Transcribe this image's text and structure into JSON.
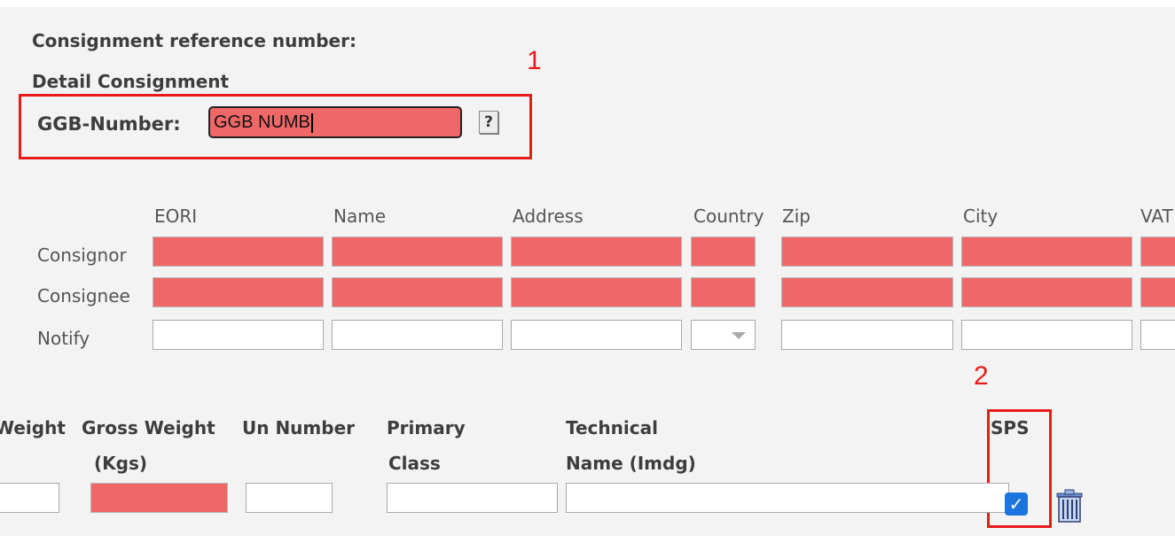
{
  "header": {
    "consignment_ref_label": "Consignment reference number:",
    "detail_label": "Detail Consignment",
    "ggb_label": "GGB-Number:",
    "ggb_value": "GGB NUMB",
    "help_label": "?"
  },
  "annotations": {
    "marker_1": "1",
    "marker_2": "2"
  },
  "parties": {
    "columns": [
      "EORI",
      "Name",
      "Address",
      "Country",
      "Zip",
      "City",
      "VAT"
    ],
    "rows": [
      {
        "label": "Consignor",
        "required": true
      },
      {
        "label": "Consignee",
        "required": true
      },
      {
        "label": "Notify",
        "required": false
      }
    ]
  },
  "goods": {
    "col_weight": "Weight",
    "col_gross_1": "Gross Weight",
    "col_gross_2": "(Kgs)",
    "col_un": "Un Number",
    "col_primary_1": "Primary",
    "col_primary_2": "Class",
    "col_tech_1": "Technical",
    "col_tech_2": "Name (Imdg)",
    "col_sps": "SPS",
    "sps_checked": true
  },
  "colors": {
    "required_field": "#f06767",
    "annotation_red": "#e81b1b",
    "checkbox_blue": "#1c74dd"
  }
}
